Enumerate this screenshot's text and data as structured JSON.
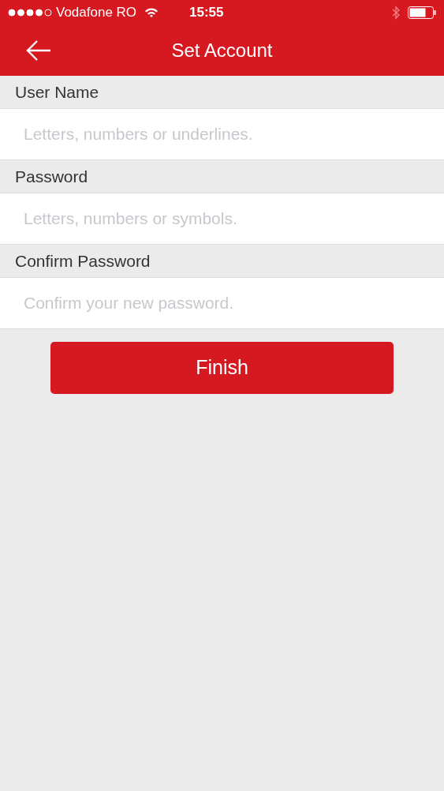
{
  "status_bar": {
    "carrier": "Vodafone RO",
    "time": "15:55"
  },
  "nav_bar": {
    "title": "Set Account"
  },
  "fields": [
    {
      "label": "User Name",
      "placeholder": "Letters, numbers or underlines."
    },
    {
      "label": "Password",
      "placeholder": "Letters, numbers or symbols."
    },
    {
      "label": "Confirm Password",
      "placeholder": "Confirm your new password."
    }
  ],
  "button": {
    "label": "Finish"
  }
}
